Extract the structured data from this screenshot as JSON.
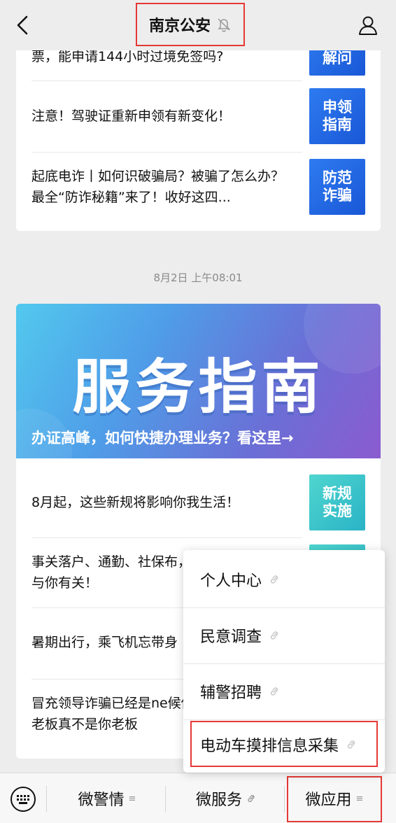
{
  "header": {
    "title": "南京公安"
  },
  "card1": {
    "items": [
      {
        "text": "票，能申请144小时过境免签吗?",
        "thumb": "解问"
      },
      {
        "text": "注意！驾驶证重新申领有新变化！",
        "thumb": "申领\n指南"
      },
      {
        "text": "起底电诈丨如何识破骗局？被骗了怎么办？最全“防诈秘籍”来了！收好这四...",
        "thumb": "防范\n诈骗"
      }
    ]
  },
  "timestamp": "8月2日 上午08:01",
  "card2": {
    "banner_title": "服务指南",
    "banner_caption": "办证高峰，如何快捷办理业务？看这里→",
    "items": [
      {
        "text": "8月起，这些新规将影响你我生活！",
        "thumb": "新规\n实施"
      },
      {
        "text": "事关落户、通勤、社保布，与你有关！",
        "thumb": ""
      },
      {
        "text": "暑期出行，乘飞机忘带身",
        "thumb": ""
      },
      {
        "text": "冒充领导诈骗已经是ne候你老板真不是你老板",
        "thumb": ""
      }
    ]
  },
  "menu": {
    "items": [
      "个人中心",
      "民意调查",
      "辅警招聘",
      "电动车摸排信息采集"
    ]
  },
  "bottom": {
    "tabs": [
      "微警情",
      "微服务",
      "微应用"
    ]
  },
  "colors": {
    "highlight": "#e53935",
    "thumb_blue": "#1f63e0",
    "thumb_teal": "#35c0cb"
  }
}
